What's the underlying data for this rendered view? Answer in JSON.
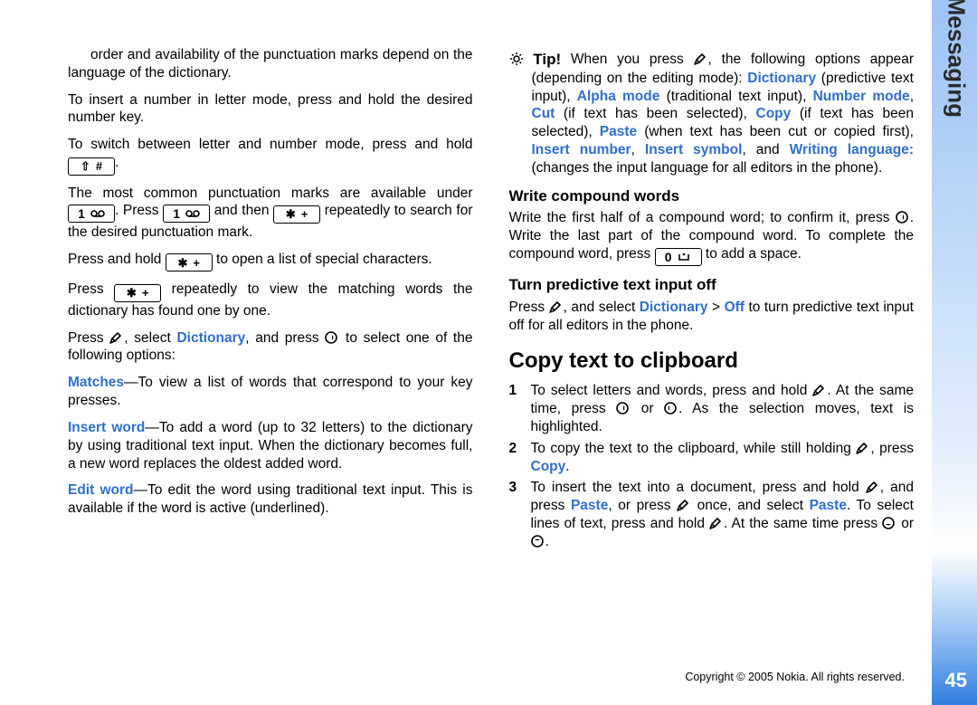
{
  "sidebar": {
    "label": "Messaging",
    "page_number": "45"
  },
  "footer": {
    "copyright": "Copyright © 2005 Nokia. All rights reserved."
  },
  "icons": {
    "shift": "⇧",
    "hash": "#",
    "one": "1",
    "star": "✱",
    "plus": "+",
    "zero": "0",
    "tip_label": "Tip!"
  },
  "terms": {
    "dictionary": "Dictionary",
    "matches": "Matches",
    "insert_word": "Insert word",
    "edit_word": "Edit word",
    "alpha_mode": "Alpha mode",
    "number_mode": "Number mode",
    "cut": "Cut",
    "copy": "Copy",
    "paste": "Paste",
    "insert_number": "Insert number",
    "insert_symbol": "Insert symbol",
    "writing_language": "Writing language:",
    "off": "Off"
  },
  "headings": {
    "write_compound": "Write compound words",
    "turn_off": "Turn predictive text input off",
    "copy_clip": "Copy text to clipboard"
  },
  "body": {
    "p_cont": "order and availability of the punctuation marks depend on the language of the dictionary.",
    "p_insert_num": "To insert a number in letter mode, press and hold the desired number key.",
    "p_switch_a": "To switch between letter and number mode, press and hold",
    "p_switch_b": ".",
    "p_punct_a": "The most common punctuation marks are available under ",
    "p_punct_b": ". Press ",
    "p_punct_c": " and then ",
    "p_punct_d": " repeatedly to search for the desired punctuation mark.",
    "p_hold_star_a": "Press and hold ",
    "p_hold_star_b": " to open a list of special characters.",
    "p_press_star_a": "Press ",
    "p_press_star_b": " repeatedly to view the matching words the dictionary has found one by one.",
    "p_pen_dict_a": "Press ",
    "p_pen_dict_b": ", select ",
    "p_pen_dict_c": ", and press ",
    "p_pen_dict_d": " to select one of the following options:",
    "p_matches": "—To view a list of words that correspond to your key presses.",
    "p_insert_word": "—To add a word (up to 32 letters) to the dictionary by using traditional text input. When the dictionary becomes full, a new word replaces the oldest added word.",
    "p_edit_word": "—To edit the word using traditional text input. This is available if the word is active (underlined).",
    "p_tip_a": " When you press ",
    "p_tip_b": ", the following options appear (depending on the editing mode): ",
    "p_tip_c": " (predictive text input), ",
    "p_tip_d": " (traditional text input), ",
    "p_tip_e": ", ",
    "p_tip_f": " (if text has been selected), ",
    "p_tip_g": " (if text has been selected), ",
    "p_tip_h": " (when text has been cut or copied first), ",
    "p_tip_i": ", ",
    "p_tip_j": ", and ",
    "p_tip_k": " (changes the input language for all editors in the phone).",
    "p_compound_a": "Write the first half of a compound word; to confirm it, press ",
    "p_compound_b": ". Write the last part of the compound word. To complete the compound word, press ",
    "p_compound_c": " to add a space.",
    "p_turnoff_a": "Press ",
    "p_turnoff_b": ", and select ",
    "p_turnoff_c": " > ",
    "p_turnoff_d": " to turn predictive text input off for all editors in the phone.",
    "li1_a": "To select letters and words, press and hold ",
    "li1_b": ". At the same time, press ",
    "li1_c": " or ",
    "li1_d": ". As the selection moves, text is highlighted.",
    "li2_a": "To copy the text to the clipboard, while still holding ",
    "li2_b": ", press ",
    "li2_c": ".",
    "li3_a": "To insert the text into a document, press and hold ",
    "li3_b": ", and press ",
    "li3_c": ", or press ",
    "li3_d": " once, and select ",
    "li3_e": ". To select lines of text, press and hold ",
    "li3_f": ". At the same time press ",
    "li3_g": " or ",
    "li3_h": "."
  },
  "list": {
    "n1": "1",
    "n2": "2",
    "n3": "3"
  }
}
